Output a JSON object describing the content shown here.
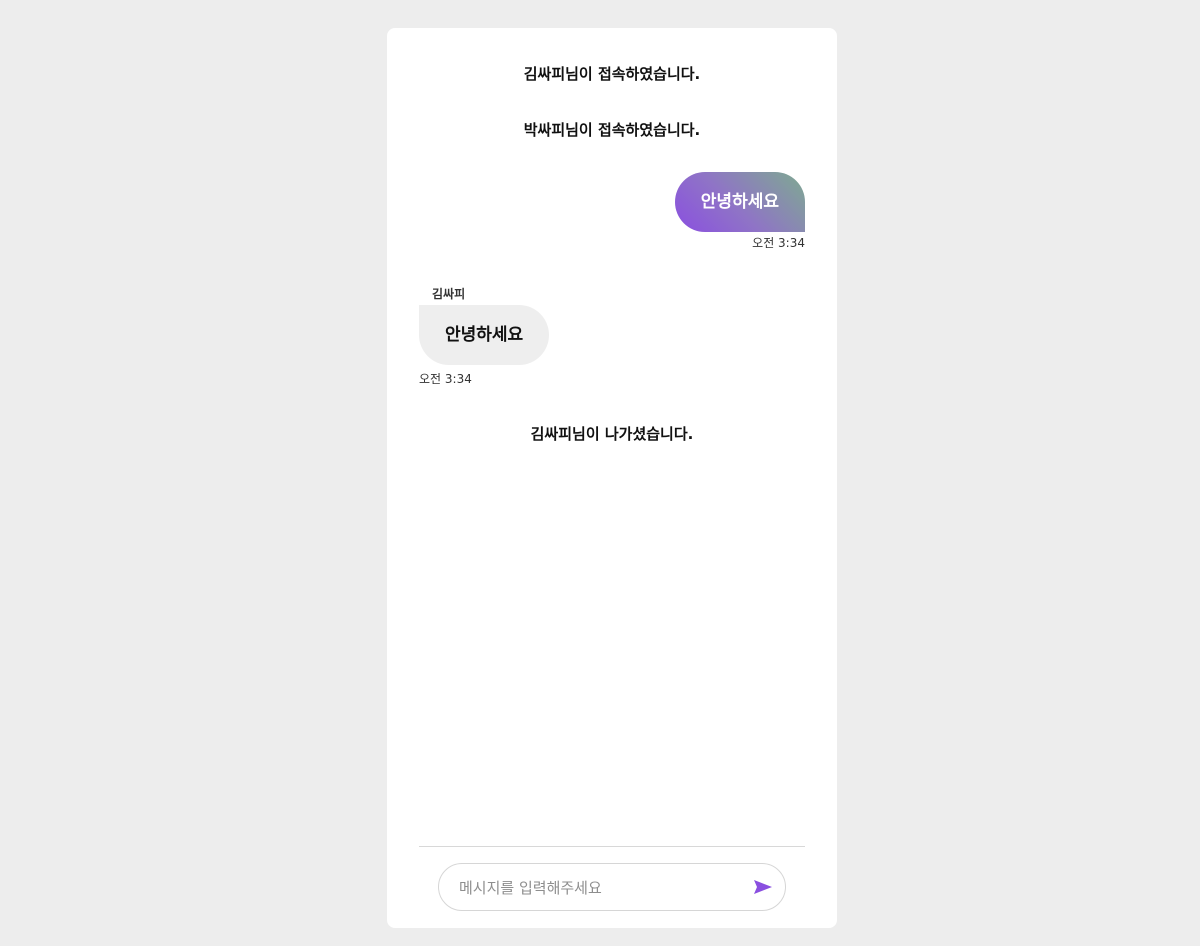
{
  "messages": {
    "system_join_1": "김싸피님이 접속하였습니다.",
    "system_join_2": "박싸피님이 접속하였습니다.",
    "mine": {
      "text": "안녕하세요",
      "time": "오전 3:34"
    },
    "other": {
      "sender": "김싸피",
      "text": "안녕하세요",
      "time": "오전 3:34"
    },
    "system_leave": "김싸피님이 나가셨습니다."
  },
  "composer": {
    "placeholder": "메시지를 입력해주세요",
    "value": "",
    "send_icon": "send-icon"
  },
  "colors": {
    "background": "#ededed",
    "card": "#ffffff",
    "mine_bubble_gradient": [
      "#8a4fe0",
      "#7eab90"
    ],
    "other_bubble": "#eeeeee",
    "send_icon": "#8a4fe0"
  }
}
